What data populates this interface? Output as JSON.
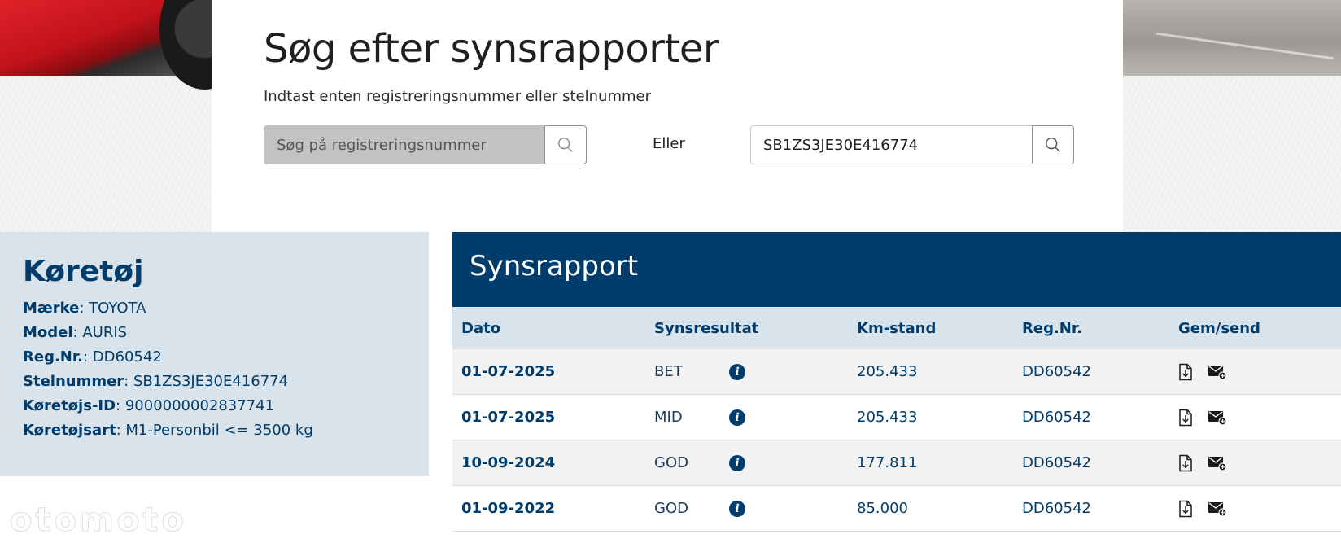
{
  "search": {
    "title": "Søg efter synsrapporter",
    "subtitle": "Indtast enten registreringsnummer eller stelnummer",
    "reg_placeholder": "Søg på registreringsnummer",
    "or_label": "Eller",
    "vin_value": "SB1ZS3JE30E416774"
  },
  "vehicle": {
    "title": "Køretøj",
    "fields": [
      {
        "key": "Mærke",
        "value": ": TOYOTA"
      },
      {
        "key": "Model",
        "value": ": AURIS"
      },
      {
        "key": "Reg.Nr.",
        "value": ": DD60542"
      },
      {
        "key": "Stelnummer",
        "value": ": SB1ZS3JE30E416774"
      },
      {
        "key": "Køretøjs-ID",
        "value": ": 9000000002837741"
      },
      {
        "key": "Køretøjsart",
        "value": ": M1-Personbil <= 3500 kg"
      }
    ]
  },
  "report": {
    "title": "Synsrapport",
    "columns": [
      "Dato",
      "Synsresultat",
      "Km-stand",
      "Reg.Nr.",
      "Gem/send"
    ],
    "rows": [
      {
        "date": "01-07-2025",
        "result": "BET",
        "km": "205.433",
        "reg": "DD60542"
      },
      {
        "date": "01-07-2025",
        "result": "MID",
        "km": "205.433",
        "reg": "DD60542"
      },
      {
        "date": "10-09-2024",
        "result": "GOD",
        "km": "177.811",
        "reg": "DD60542"
      },
      {
        "date": "01-09-2022",
        "result": "GOD",
        "km": "85.000",
        "reg": "DD60542"
      }
    ]
  },
  "watermark": "otomoto",
  "colors": {
    "brand": "#003c6c",
    "panel": "#d8e3ec"
  }
}
